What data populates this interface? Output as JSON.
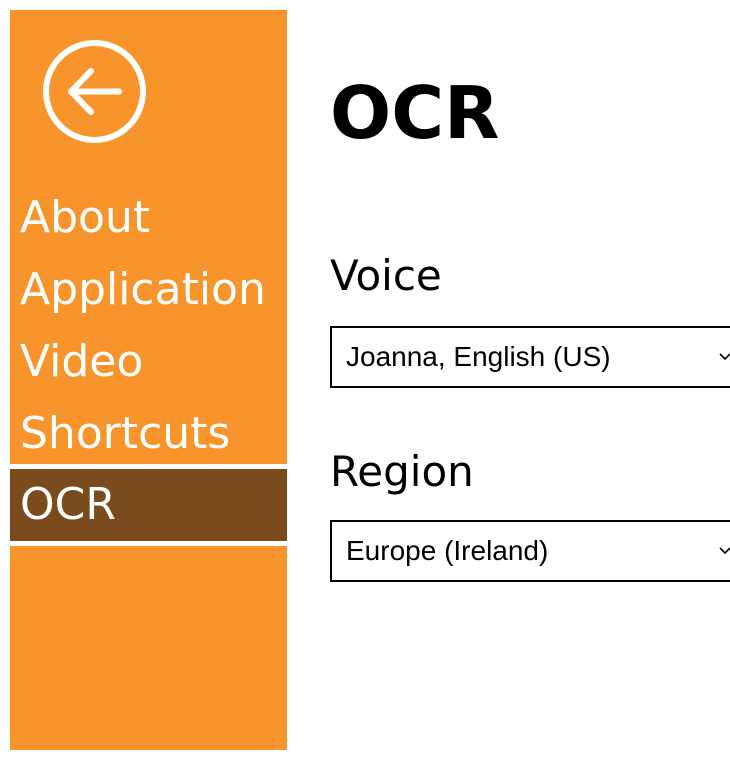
{
  "sidebar": {
    "back_icon": "arrow-left-circle-icon",
    "items": [
      {
        "label": "About"
      },
      {
        "label": "Application"
      },
      {
        "label": "Video"
      },
      {
        "label": "Shortcuts"
      },
      {
        "label": "OCR",
        "selected": true
      }
    ]
  },
  "main": {
    "title": "OCR",
    "voice": {
      "label": "Voice",
      "value": "Joanna, English (US)"
    },
    "region": {
      "label": "Region",
      "value": "Europe (Ireland)"
    }
  },
  "colors": {
    "sidebar_bg": "#f7952c",
    "selected_bg": "#7a4b1c",
    "text_light": "#ffffff"
  }
}
